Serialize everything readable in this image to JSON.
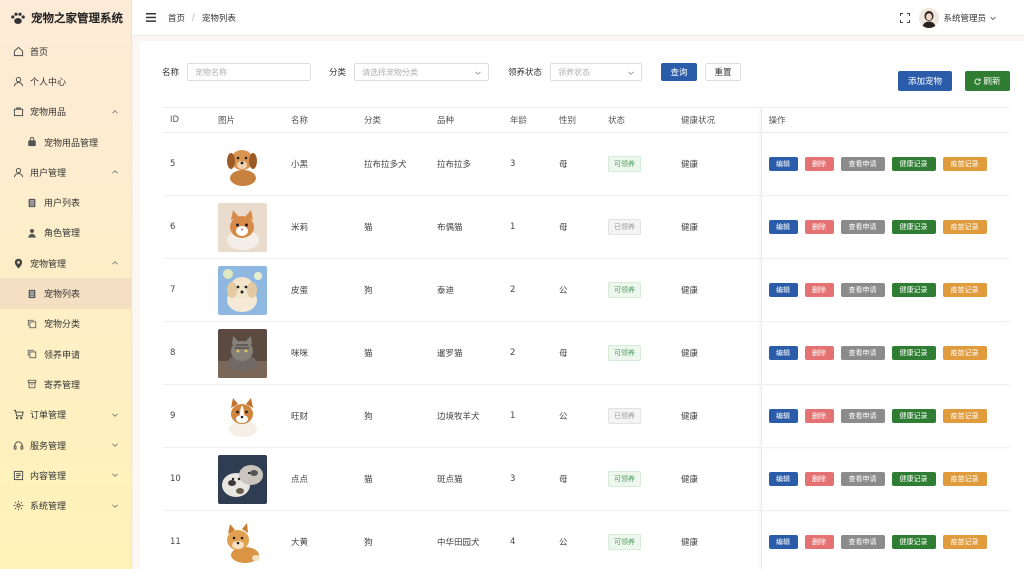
{
  "brand": {
    "title": "宠物之家管理系统"
  },
  "sidebar": {
    "items": [
      {
        "label": "首页",
        "icon": "home-icon",
        "level": 0
      },
      {
        "label": "个人中心",
        "icon": "user-icon",
        "level": 0
      },
      {
        "label": "宠物用品",
        "icon": "bag-icon",
        "level": 0,
        "chevron": "up"
      },
      {
        "label": "宠物用品管理",
        "icon": "lock-bag-icon",
        "level": 1
      },
      {
        "label": "用户管理",
        "icon": "user-icon",
        "level": 0,
        "chevron": "up"
      },
      {
        "label": "用户列表",
        "icon": "list-icon",
        "level": 1
      },
      {
        "label": "角色管理",
        "icon": "person-icon",
        "level": 1
      },
      {
        "label": "宠物管理",
        "icon": "pin-icon",
        "level": 0,
        "chevron": "up"
      },
      {
        "label": "宠物列表",
        "icon": "list-icon",
        "level": 1,
        "active": true
      },
      {
        "label": "宠物分类",
        "icon": "copy-icon",
        "level": 1
      },
      {
        "label": "领养申请",
        "icon": "copy-icon",
        "level": 1
      },
      {
        "label": "寄养管理",
        "icon": "box-icon",
        "level": 1
      },
      {
        "label": "订单管理",
        "icon": "cart-icon",
        "level": 0,
        "chevron": "down"
      },
      {
        "label": "服务管理",
        "icon": "headset-icon",
        "level": 0,
        "chevron": "down"
      },
      {
        "label": "内容管理",
        "icon": "doc-icon",
        "level": 0,
        "chevron": "down"
      },
      {
        "label": "系统管理",
        "icon": "gear-icon",
        "level": 0,
        "chevron": "down"
      }
    ]
  },
  "header": {
    "breadcrumb": [
      "首页",
      "宠物列表"
    ],
    "user_name": "系统管理员"
  },
  "filters": {
    "name_label": "名称",
    "name_placeholder": "宠物名称",
    "category_label": "分类",
    "category_placeholder": "请选择宠物分类",
    "status_label": "领养状态",
    "status_placeholder": "领养状态",
    "query_label": "查询",
    "reset_label": "重置"
  },
  "actions": {
    "add_label": "添加宠物",
    "refresh_label": "刷新"
  },
  "table": {
    "columns": [
      "ID",
      "图片",
      "名称",
      "分类",
      "品种",
      "年龄",
      "性别",
      "状态",
      "健康状况",
      "操作"
    ],
    "op_labels": {
      "edit": "编辑",
      "delete": "删除",
      "view": "查看申请",
      "health": "健康记录",
      "vaccine": "疫苗记录"
    },
    "rows": [
      {
        "id": "5",
        "name": "小黑",
        "category": "拉布拉多犬",
        "breed": "拉布拉多",
        "age": "3",
        "gender": "母",
        "status": "可领养",
        "status_type": "ok",
        "health": "健康",
        "img": "dog-brown"
      },
      {
        "id": "6",
        "name": "米莉",
        "category": "猫",
        "breed": "布偶猫",
        "age": "1",
        "gender": "母",
        "status": "已领养",
        "status_type": "done",
        "health": "健康",
        "img": "cat-orange"
      },
      {
        "id": "7",
        "name": "皮蛋",
        "category": "狗",
        "breed": "泰迪",
        "age": "2",
        "gender": "公",
        "status": "可领养",
        "status_type": "ok",
        "health": "健康",
        "img": "dog-fluffy"
      },
      {
        "id": "8",
        "name": "咪咪",
        "category": "猫",
        "breed": "暹罗猫",
        "age": "2",
        "gender": "母",
        "status": "可领养",
        "status_type": "ok",
        "health": "健康",
        "img": "cat-tabby"
      },
      {
        "id": "9",
        "name": "旺财",
        "category": "狗",
        "breed": "边境牧羊犬",
        "age": "1",
        "gender": "公",
        "status": "已领养",
        "status_type": "done",
        "health": "健康",
        "img": "dog-corgi"
      },
      {
        "id": "10",
        "name": "点点",
        "category": "猫",
        "breed": "斑点猫",
        "age": "3",
        "gender": "母",
        "status": "可领养",
        "status_type": "ok",
        "health": "健康",
        "img": "cat-spotted"
      },
      {
        "id": "11",
        "name": "大黄",
        "category": "狗",
        "breed": "中华田园犬",
        "age": "4",
        "gender": "公",
        "status": "可领养",
        "status_type": "ok",
        "health": "健康",
        "img": "dog-shiba"
      }
    ]
  },
  "colors": {
    "primary": "#2a5caa",
    "danger": "#e57272",
    "info": "#8b8b8b",
    "success": "#2f7d32",
    "warning": "#e09c3c"
  }
}
